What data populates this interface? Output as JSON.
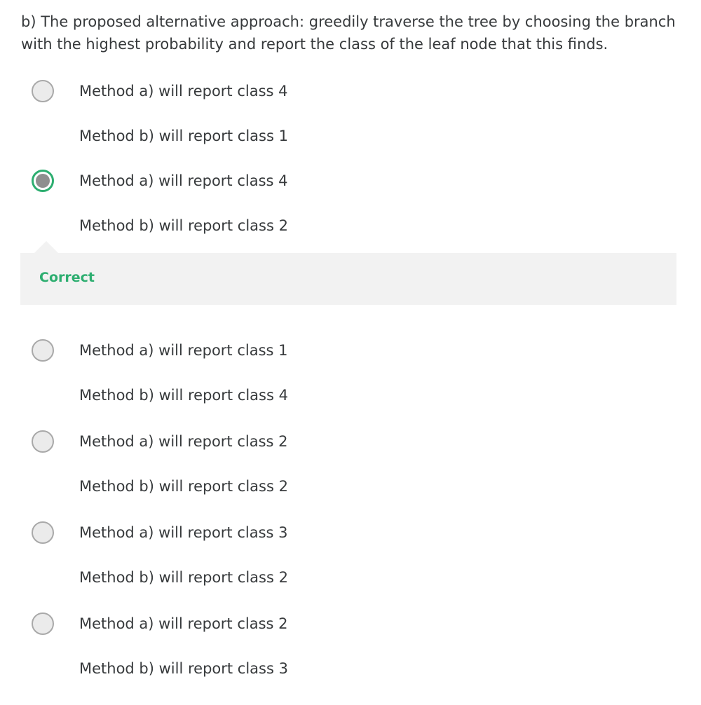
{
  "question": {
    "text": "b) The proposed alternative approach: greedily traverse the tree by choosing the branch with the highest probability and report the class of the leaf node that this finds."
  },
  "options": [
    {
      "line1": "Method a) will report class 4",
      "line2": "Method b) will report class 1",
      "selected": false
    },
    {
      "line1": "Method a) will report class 4",
      "line2": "Method b) will report class 2",
      "selected": true
    },
    {
      "line1": "Method a) will report class 1",
      "line2": "Method b) will report class 4",
      "selected": false
    },
    {
      "line1": "Method a) will report class 2",
      "line2": "Method b) will report class 2",
      "selected": false
    },
    {
      "line1": "Method a) will report class 3",
      "line2": "Method b) will report class 2",
      "selected": false
    },
    {
      "line1": "Method a) will report class 2",
      "line2": "Method b) will report class 3",
      "selected": false
    }
  ],
  "feedback": {
    "status": "Correct",
    "color": "#2dae70"
  },
  "colors": {
    "text": "#373a3c",
    "accent": "#2dae70",
    "feedback_bg": "#f2f2f2"
  }
}
